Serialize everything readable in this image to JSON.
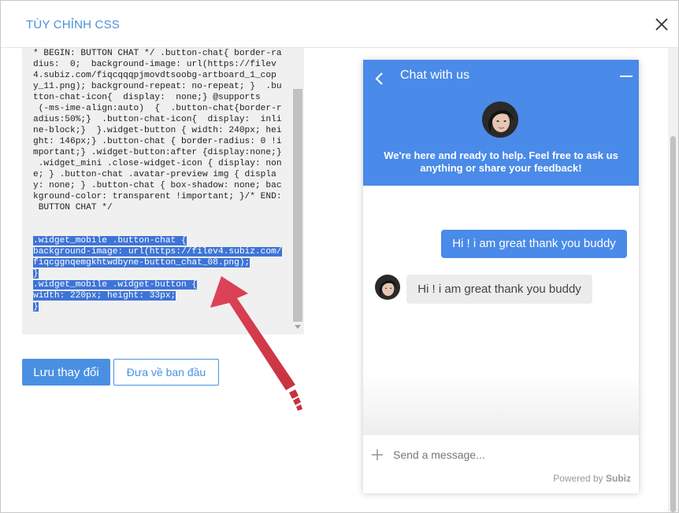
{
  "modal": {
    "title": "TÙY CHỈNH CSS",
    "close_icon": "close-icon"
  },
  "editor": {
    "code_lines": [
      "* BEGIN: BUTTON CHAT */ .button-chat{ border-ra",
      "dius:  0;  background-image: url(https://filev",
      "4.subiz.com/fiqcqqqpjmovdtsoobg-artboard_1_cop",
      "y_11.png); background-repeat: no-repeat; }  .bu",
      "tton-chat-icon{  display:  none;} @supports",
      " (-ms-ime-align:auto)  {  .button-chat{border-r",
      "adius:50%;}  .button-chat-icon{  display:  inli",
      "ne-block;}  }.widget-button { width: 240px; hei",
      "ght: 146px;} .button-chat { border-radius: 0 !i",
      "mportant;} .widget-button:after {display:none;}",
      " .widget_mini .close-widget-icon { display: non",
      "e; } .button-chat .avatar-preview img { displa",
      "y: none; } .button-chat { box-shadow: none; bac",
      "kground-color: transparent !important; }/* END:",
      " BUTTON CHAT */",
      "",
      "",
      ".widget_mobile .button-chat {",
      "background-image: url(https://filev4.subiz.com/",
      "fiqcggnqemgkhtwdbyne-button_chat_08.png);",
      "}",
      ".widget_mobile .widget-button {",
      "width: 220px; height: 33px;",
      "}"
    ],
    "selected_from_line": 17
  },
  "buttons": {
    "save_label": "Lưu thay đổi",
    "reset_label": "Đưa về ban đầu"
  },
  "widget": {
    "title": "Chat with us",
    "back_icon": "chevron-left-icon",
    "minimize_icon": "minimize-icon",
    "intro_text": "We're here and ready to help. Feel free to ask us anything or share your feedback!",
    "messages": [
      {
        "direction": "out",
        "text": "Hi ! i am great thank you buddy"
      },
      {
        "direction": "in",
        "text": "Hi ! i am great thank you buddy"
      }
    ],
    "input_placeholder": "Send a message...",
    "attach_icon": "plus-icon",
    "powered_prefix": "Powered by",
    "powered_brand": "Subiz"
  },
  "colors": {
    "accent": "#4a8ae8",
    "title_blue": "#4a90d9",
    "annotation_arrow": "#d9424f"
  }
}
